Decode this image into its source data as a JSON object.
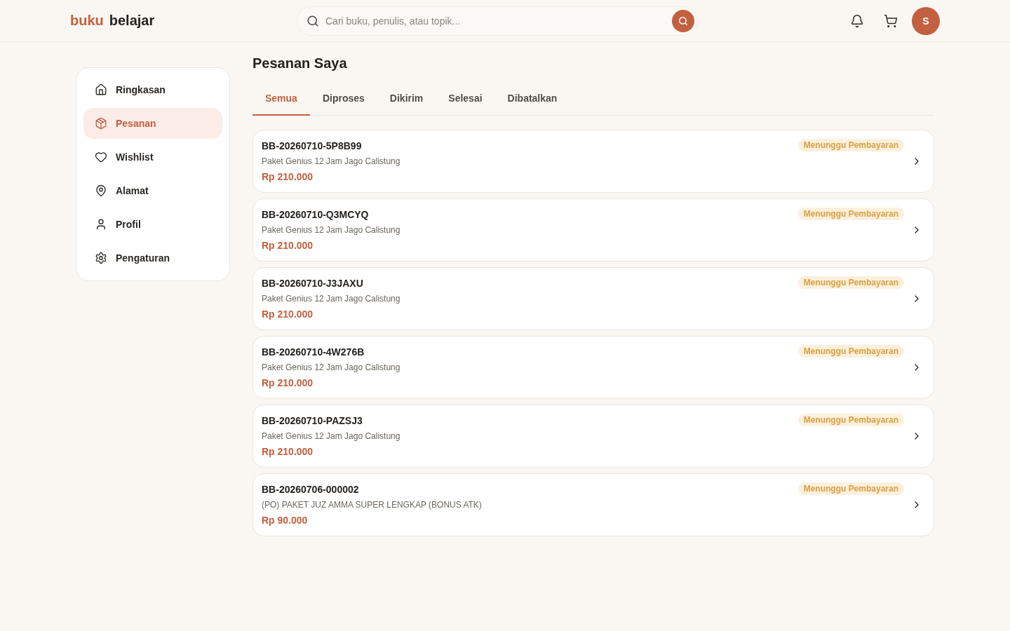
{
  "header": {
    "logo": [
      "buku",
      "belajar"
    ],
    "search": {
      "placeholder": "Cari buku, penulis, atau topik..."
    },
    "avatar": "S"
  },
  "sidebar": {
    "items": [
      {
        "label": "Ringkasan",
        "selected": false
      },
      {
        "label": "Pesanan",
        "selected": true
      },
      {
        "label": "Wishlist",
        "selected": false
      },
      {
        "label": "Alamat",
        "selected": false
      },
      {
        "label": "Profil",
        "selected": false
      },
      {
        "label": "Pengaturan",
        "selected": false
      }
    ]
  },
  "page_title": "Pesanan Saya",
  "tabs": [
    {
      "label": "Semua",
      "selected": true
    },
    {
      "label": "Diproses",
      "selected": false
    },
    {
      "label": "Dikirim",
      "selected": false
    },
    {
      "label": "Selesai",
      "selected": false
    },
    {
      "label": "Dibatalkan",
      "selected": false
    }
  ],
  "orders": [
    {
      "id": "BB-20260710-5P8B99",
      "product": "Paket Genius 12 Jam Jago Calistung",
      "price": "Rp 210.000",
      "status": "Menunggu Pembayaran"
    },
    {
      "id": "BB-20260710-Q3MCYQ",
      "product": "Paket Genius 12 Jam Jago Calistung",
      "price": "Rp 210.000",
      "status": "Menunggu Pembayaran"
    },
    {
      "id": "BB-20260710-J3JAXU",
      "product": "Paket Genius 12 Jam Jago Calistung",
      "price": "Rp 210.000",
      "status": "Menunggu Pembayaran"
    },
    {
      "id": "BB-20260710-4W276B",
      "product": "Paket Genius 12 Jam Jago Calistung",
      "price": "Rp 210.000",
      "status": "Menunggu Pembayaran"
    },
    {
      "id": "BB-20260710-PAZSJ3",
      "product": "Paket Genius 12 Jam Jago Calistung",
      "price": "Rp 210.000",
      "status": "Menunggu Pembayaran"
    },
    {
      "id": "BB-20260706-000002",
      "product": "(PO) PAKET JUZ AMMA SUPER LENGKAP (BONUS ATK)",
      "price": "Rp 90.000",
      "status": "Menunggu Pembayaran"
    }
  ]
}
